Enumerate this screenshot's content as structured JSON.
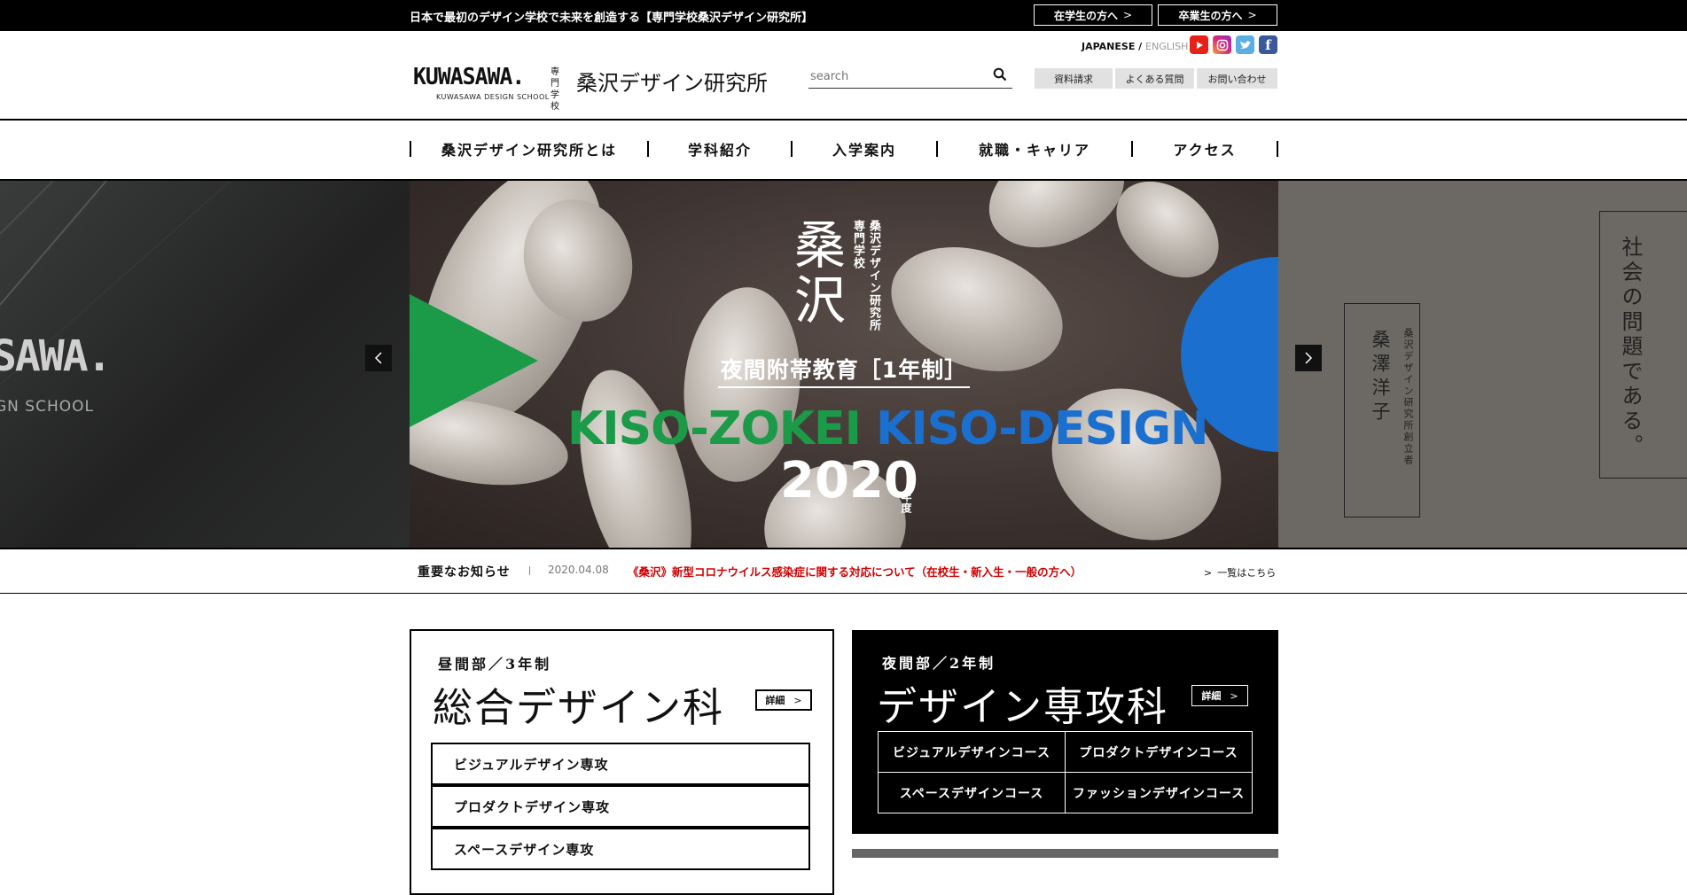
{
  "topbar": {
    "tagline": "日本で最初のデザイン学校で未来を創造する【専門学校桑沢デザイン研究所】",
    "btn_students": "在学生の方へ",
    "btn_alumni": "卒業生の方へ"
  },
  "logo": {
    "mark": "KUWASAWA.",
    "sub": "KUWASAWA DESIGN SCHOOL",
    "senmon": "専門学校",
    "name": "桑沢デザイン研究所"
  },
  "lang": {
    "ja": "JAPANESE",
    "sep": "/",
    "en": "ENGLISH"
  },
  "social": {
    "youtube_color": "#e62117",
    "instagram_color": "#c13584",
    "twitter_color": "#1da1f2",
    "facebook_color": "#3b5998",
    "youtube_icon": "youtube-icon",
    "instagram_icon": "instagram-icon",
    "twitter_icon": "twitter-icon",
    "facebook_icon": "facebook-icon"
  },
  "search": {
    "placeholder": "search",
    "icon": "search-icon"
  },
  "header_buttons": {
    "request": "資料請求",
    "faq": "よくある質問",
    "contact": "お問い合わせ"
  },
  "nav": {
    "about": "桑沢デザイン研究所とは",
    "departments": "学科紹介",
    "admission": "入学案内",
    "career": "就職・キャリア",
    "access": "アクセス"
  },
  "hero": {
    "left_logo": "SAWA.",
    "left_sub": "GN SCHOOL",
    "kanji": "桑沢",
    "vertical_school": "専門学校",
    "vertical_name": "桑沢デザイン研究所",
    "subtitle": "夜間附帯教育［1年制］",
    "title_green": "KISO-ZOKEI",
    "title_blue": "KISO-DESIGN",
    "year": "2020",
    "year_suffix": "年度",
    "accent_green": "#1b9a48",
    "accent_blue": "#1a6fcf",
    "right_quote": "社会の問題である。",
    "right_name": "桑澤洋子",
    "right_role": "桑沢デザイン研究所創立者"
  },
  "news": {
    "label": "重要なお知らせ",
    "date": "2020.04.08",
    "text": "《桑沢》新型コロナウイルス感染症に関する対応について（在校生・新入生・一般の方へ）",
    "more": "一覧はこちら",
    "alert_color": "#d00000"
  },
  "card_day": {
    "sub": "昼間部／3年制",
    "title": "総合デザイン科",
    "detail": "詳細",
    "majors": [
      "ビジュアルデザイン専攻",
      "プロダクトデザイン専攻",
      "スペースデザイン専攻"
    ]
  },
  "card_night": {
    "sub": "夜間部／2年制",
    "title": "デザイン専攻科",
    "detail": "詳細",
    "courses": [
      "ビジュアルデザインコース",
      "プロダクトデザインコース",
      "スペースデザインコース",
      "ファッションデザインコース"
    ]
  }
}
